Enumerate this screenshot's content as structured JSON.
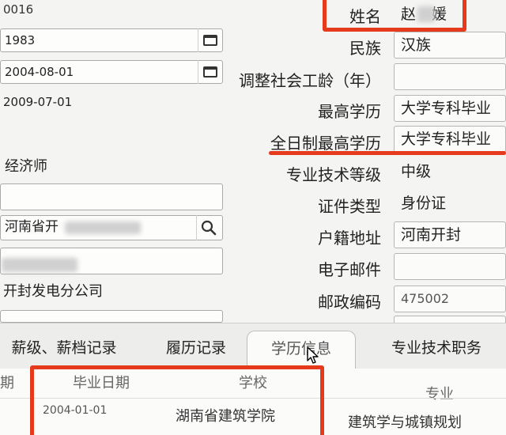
{
  "left_form": {
    "top_value": "0016",
    "year_value": "1983",
    "date1_value": "2004-08-01",
    "date2_value": "2009-07-01",
    "title_value": "经济师",
    "address_value": "河南省开",
    "company_value": "开封发电分公司"
  },
  "right_form": {
    "fields": [
      {
        "label": "姓名",
        "value": "赵"
      },
      {
        "label": "民族",
        "value": "汉族"
      },
      {
        "label": "调整社会工龄（年）",
        "value": ""
      },
      {
        "label": "最高学历",
        "value": "大学专科毕业"
      },
      {
        "label": "全日制最高学历",
        "value": "大学专科毕业"
      },
      {
        "label": "专业技术等级",
        "value": "中级"
      },
      {
        "label": "证件类型",
        "value": "身份证"
      },
      {
        "label": "户籍地址",
        "value": "河南开封"
      },
      {
        "label": "电子邮件",
        "value": ""
      },
      {
        "label": "邮政编码",
        "value": "475002"
      }
    ],
    "name_suffix": "媛"
  },
  "tabs": [
    {
      "label": "薪级、薪档记录"
    },
    {
      "label": "履历记录"
    },
    {
      "label": "学历信息"
    },
    {
      "label": "专业技术职务"
    }
  ],
  "grid": {
    "partial_header": "期",
    "columns": [
      "毕业日期",
      "学校",
      "专业"
    ],
    "rows": [
      {
        "date": "2004-01-01",
        "school": "湖南省建筑学院",
        "major": "建筑学与城镇规划"
      }
    ]
  },
  "colors": {
    "annotation": "#e53a1c"
  },
  "icons": [
    "calendar-icon",
    "calendar-icon",
    "search-icon",
    "mouse-cursor-icon"
  ]
}
